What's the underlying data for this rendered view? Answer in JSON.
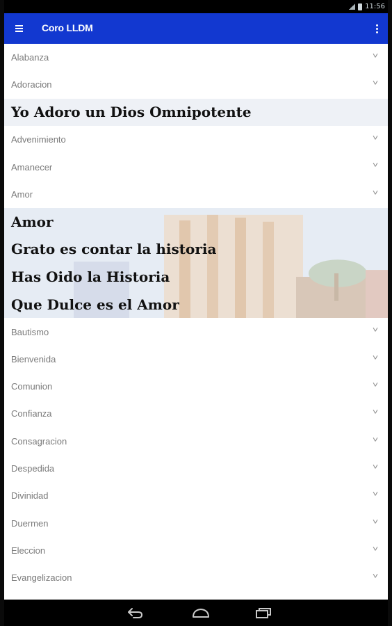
{
  "statusbar": {
    "time": "11:56"
  },
  "appbar": {
    "title": "Coro LLDM"
  },
  "list": [
    {
      "type": "category",
      "label": "Alabanza"
    },
    {
      "type": "category",
      "label": "Adoracion"
    },
    {
      "type": "songs",
      "style": "plain",
      "songs": [
        "Yo Adoro un Dios Omnipotente"
      ]
    },
    {
      "type": "category",
      "label": "Advenimiento"
    },
    {
      "type": "category",
      "label": "Amanecer"
    },
    {
      "type": "category",
      "label": "Amor"
    },
    {
      "type": "songs",
      "style": "photo",
      "songs": [
        "Amor",
        "Grato es contar la historia",
        "Has Oido la Historia",
        "Que Dulce es el Amor"
      ]
    },
    {
      "type": "category",
      "label": "Bautismo"
    },
    {
      "type": "category",
      "label": "Bienvenida"
    },
    {
      "type": "category",
      "label": "Comunion"
    },
    {
      "type": "category",
      "label": "Confianza"
    },
    {
      "type": "category",
      "label": "Consagracion"
    },
    {
      "type": "category",
      "label": "Despedida"
    },
    {
      "type": "category",
      "label": "Divinidad"
    },
    {
      "type": "category",
      "label": "Duermen"
    },
    {
      "type": "category",
      "label": "Eleccion"
    },
    {
      "type": "category",
      "label": "Evangelizacion"
    }
  ],
  "icons": {
    "menu": "hamburger-menu-icon",
    "overflow": "vertical-dots-icon",
    "expand": "chevron-down-icon",
    "back": "back-arrow-icon",
    "home": "home-icon",
    "recents": "recent-apps-icon"
  },
  "colors": {
    "appbar": "#1238d0",
    "song_highlight": "#eef1f6",
    "category_text": "#7a7a7a"
  }
}
